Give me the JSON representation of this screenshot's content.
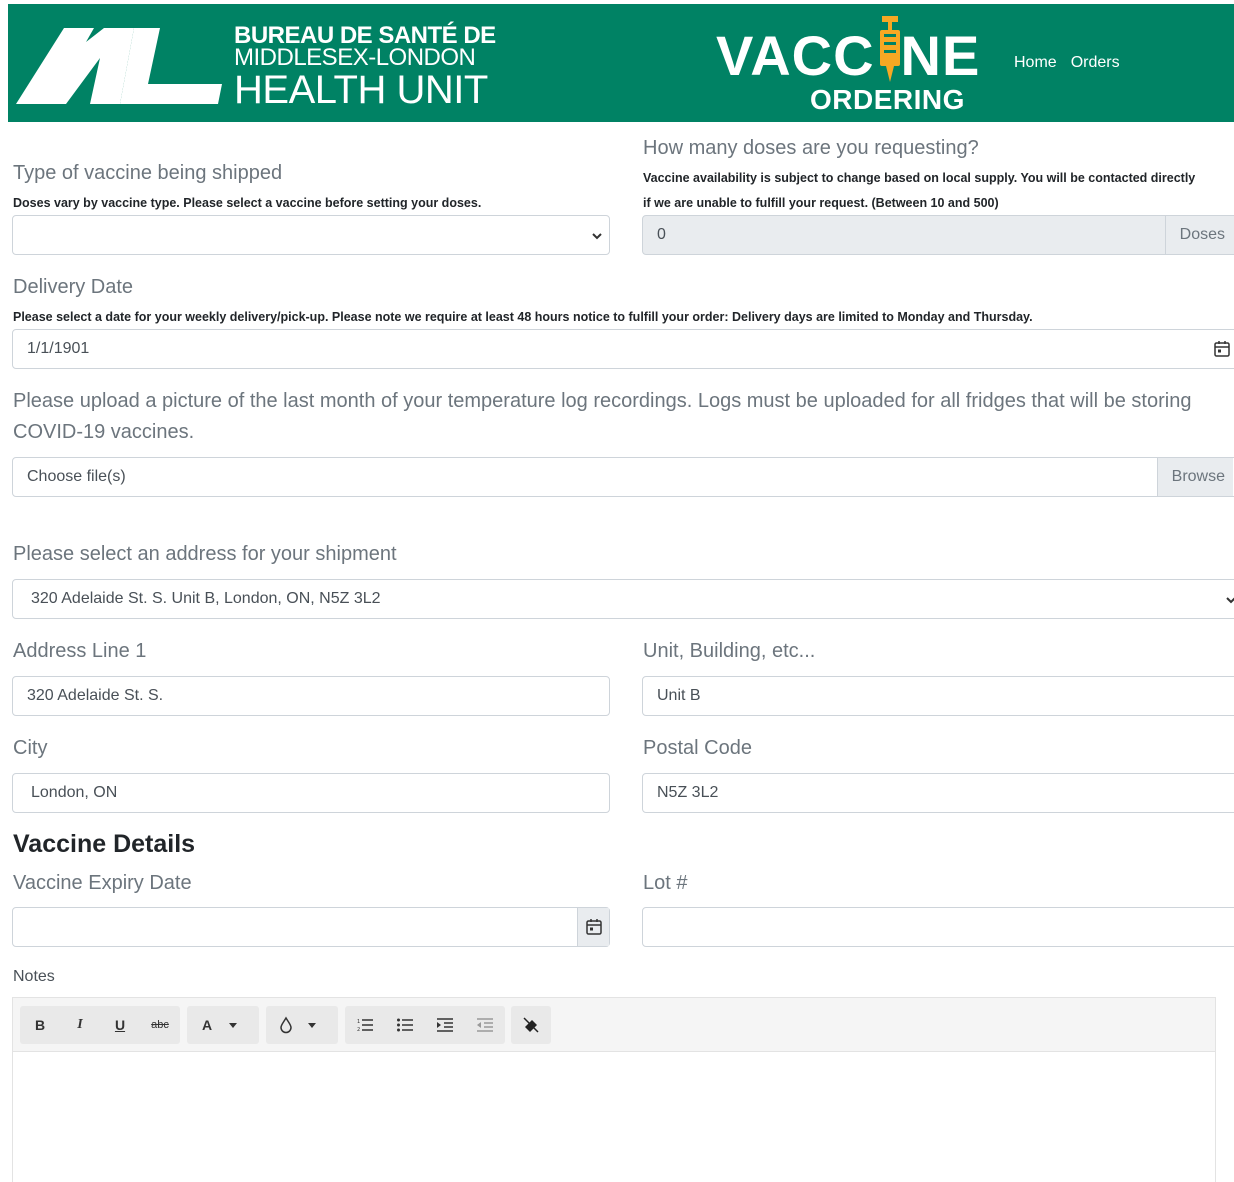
{
  "header": {
    "health_unit": {
      "line1": "BUREAU DE SANTÉ DE",
      "line2": "MIDDLESEX-LONDON",
      "line3": "HEALTH UNIT"
    },
    "vaccine_logo": {
      "left_text": "VACC",
      "right_text": "NE",
      "subtitle": "ORDERING"
    },
    "nav": [
      {
        "label": "Home"
      },
      {
        "label": "Orders"
      }
    ],
    "colors": {
      "brand_green": "#008264",
      "accent_orange": "#f7a823"
    }
  },
  "form": {
    "vaccine_type": {
      "label": "Type of vaccine being shipped",
      "hint": "Doses vary by vaccine type. Please select a vaccine before setting your doses.",
      "value": ""
    },
    "doses": {
      "label": "How many doses are you requesting?",
      "hint_line1": "Vaccine availability is subject to change based on local supply. You will be contacted directly",
      "hint_line2": "if we are unable to fulfill your request. (Between 10 and 500)",
      "value": "0",
      "addon": "Doses"
    },
    "delivery_date": {
      "label": "Delivery Date",
      "hint": "Please select a date for your weekly delivery/pick-up. Please note we require at least 48 hours notice to fulfill your order: Delivery days are limited to Monday and Thursday.",
      "value": "1/1/1901"
    },
    "upload": {
      "label_line1": "Please upload a picture of the last month of your temperature log recordings. Logs must be uploaded for all fridges that will be storing",
      "label_line2": "COVID-19 vaccines.",
      "placeholder": "Choose file(s)",
      "browse": "Browse"
    },
    "shipment_address": {
      "label": "Please select an address for your shipment",
      "value": "320 Adelaide St. S. Unit B, London, ON, N5Z 3L2"
    },
    "address_line1": {
      "label": "Address Line 1",
      "value": "320 Adelaide St. S."
    },
    "unit": {
      "label": "Unit, Building, etc...",
      "value": "Unit B"
    },
    "city": {
      "label": "City",
      "value": "London, ON"
    },
    "postal_code": {
      "label": "Postal Code",
      "value": "N5Z 3L2"
    }
  },
  "vaccine_details": {
    "title": "Vaccine Details",
    "expiry": {
      "label": "Vaccine Expiry Date",
      "value": ""
    },
    "lot": {
      "label": "Lot #",
      "value": ""
    },
    "notes": {
      "label": "Notes",
      "toolbar": {
        "bold": "B",
        "italic": "I",
        "underline": "U",
        "strike": "abc",
        "font_color": "A"
      }
    }
  }
}
